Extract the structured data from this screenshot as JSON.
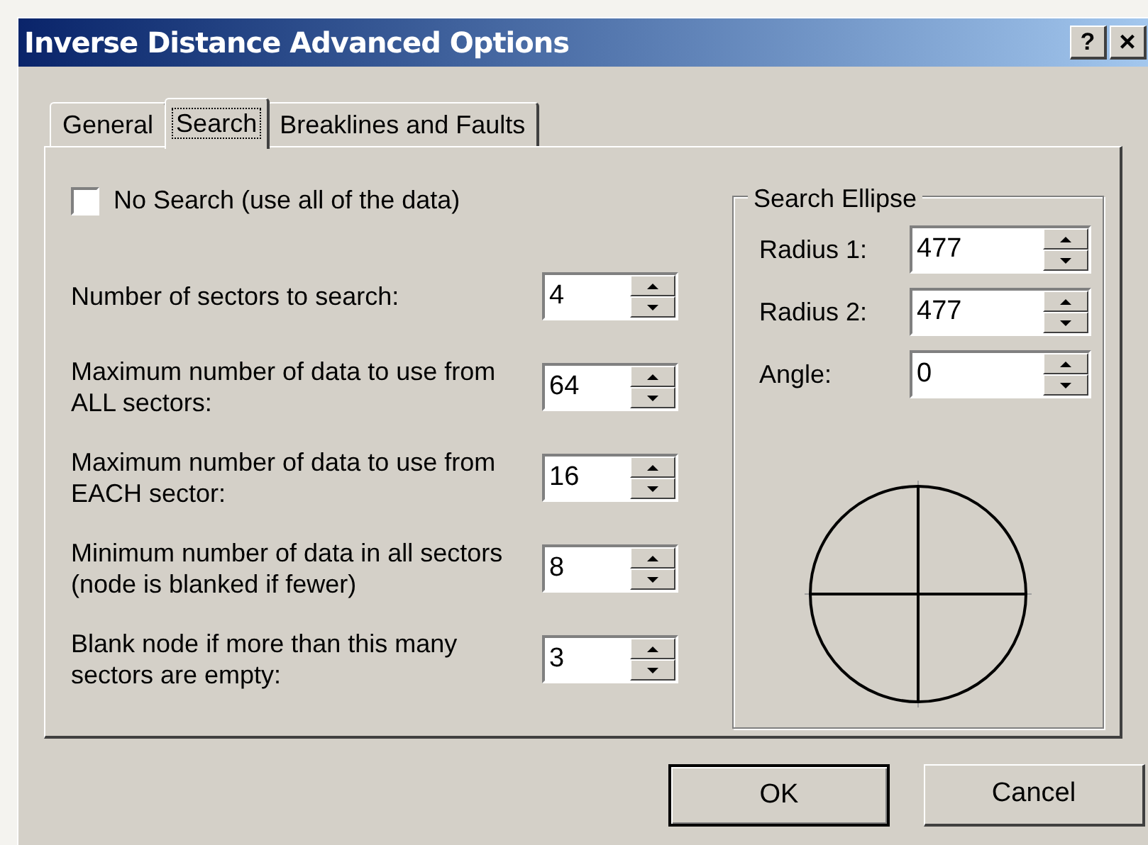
{
  "window": {
    "title": "Inverse Distance Advanced Options",
    "help_button": "?",
    "close_button": "×"
  },
  "tabs": [
    {
      "label": "General",
      "selected": false
    },
    {
      "label": "Search",
      "selected": true
    },
    {
      "label": "Breaklines and Faults",
      "selected": false
    }
  ],
  "no_search": {
    "label": "No Search (use all of the data)",
    "checked": false
  },
  "fields": [
    {
      "label": "Number of sectors to search:",
      "value": "4"
    },
    {
      "label": "Maximum number of data to use from ALL sectors:",
      "value": "64"
    },
    {
      "label": "Maximum number of data to use from EACH sector:",
      "value": "16"
    },
    {
      "label": "Minimum number of data in all sectors (node is blanked if fewer)",
      "value": "8"
    },
    {
      "label": "Blank node if more than this many sectors are empty:",
      "value": "3"
    }
  ],
  "search_ellipse": {
    "title": "Search Ellipse",
    "fields": [
      {
        "label": "Radius 1:",
        "value": "477"
      },
      {
        "label": "Radius 2:",
        "value": "477"
      },
      {
        "label": "Angle:",
        "value": "0"
      }
    ]
  },
  "buttons": [
    "OK",
    "Cancel"
  ]
}
